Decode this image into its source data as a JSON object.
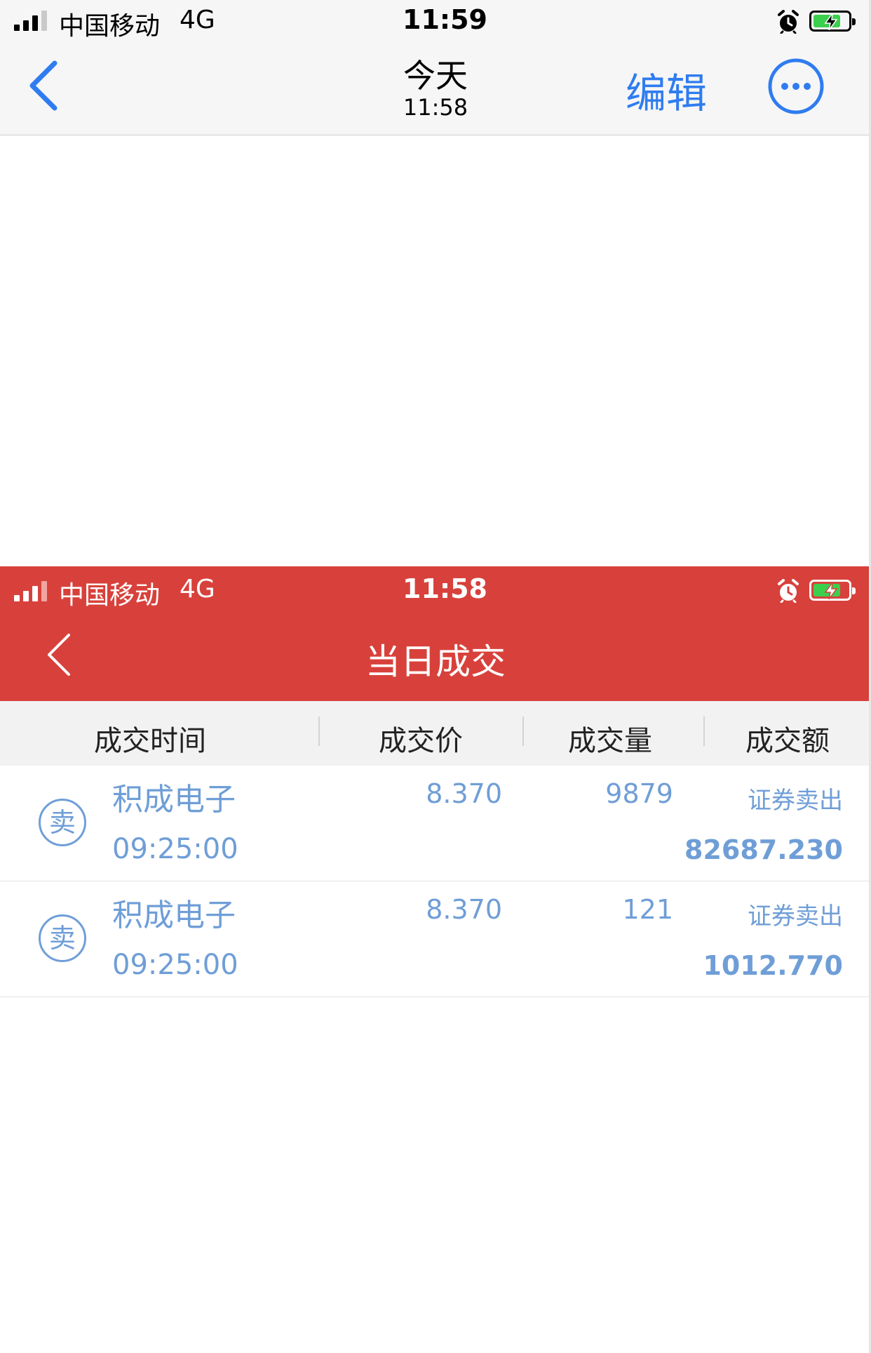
{
  "outer_status": {
    "carrier": "中国移动",
    "network": "4G",
    "time": "11:59"
  },
  "outer_nav": {
    "title": "今天",
    "subtitle": "11:58",
    "edit_label": "编辑"
  },
  "inner_status": {
    "carrier": "中国移动",
    "network": "4G",
    "time": "11:58"
  },
  "inner_nav": {
    "title": "当日成交"
  },
  "table": {
    "headers": [
      "成交时间",
      "成交价",
      "成交量",
      "成交额"
    ],
    "rows": [
      {
        "badge": "卖",
        "name": "积成电子",
        "time": "09:25:00",
        "price": "8.370",
        "volume": "9879",
        "type": "证券卖出",
        "amount": "82687.230"
      },
      {
        "badge": "卖",
        "name": "积成电子",
        "time": "09:25:00",
        "price": "8.370",
        "volume": "121",
        "type": "证券卖出",
        "amount": "1012.770"
      }
    ]
  },
  "colors": {
    "accent_blue": "#2f7cf0",
    "header_red": "#d8413b",
    "row_text_blue": "#6f9ed7",
    "battery_green": "#3ccf4e"
  },
  "icons": {
    "outer_back": "chevron-left-icon",
    "more": "more-horizontal-icon",
    "alarm": "alarm-clock-icon",
    "battery": "battery-charging-icon",
    "inner_back": "chevron-left-icon"
  }
}
